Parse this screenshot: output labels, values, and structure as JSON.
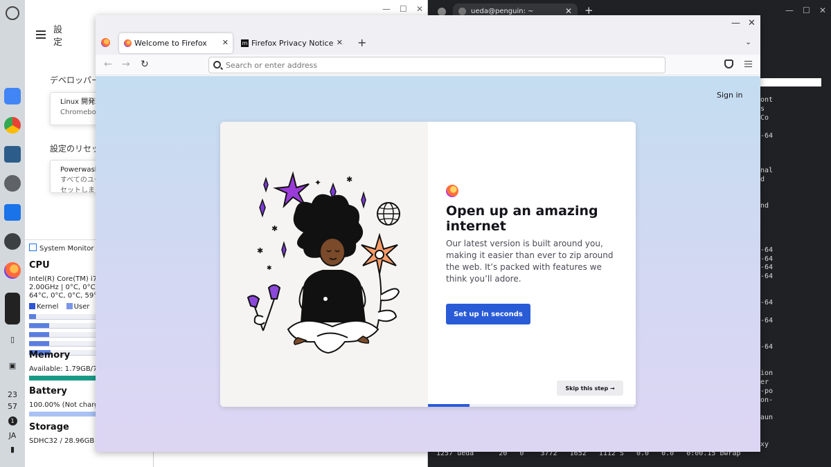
{
  "shelf": {
    "apps": [
      "files-icon",
      "chrome-icon",
      "gallery-icon",
      "settings-icon",
      "system-monitor-icon",
      "terminal-icon",
      "firefox-icon",
      "media-icon"
    ],
    "tray": {
      "hour": "23",
      "minute": "57",
      "notifications": "1",
      "ime": "JA"
    }
  },
  "settings": {
    "title": "設定",
    "developer_section": "デベロッパー",
    "linux_card_title": "Linux 開発環",
    "linux_card_sub": "Chromebook",
    "reset_section": "設定のリセッ",
    "powerwash_title": "Powerwash",
    "powerwash_sub1": "すべてのユー",
    "powerwash_sub2": "セットします"
  },
  "sysmon": {
    "title": "System Monitor",
    "cpu_heading": "CPU",
    "cpu_line1": "Intel(R) Core(TM) i7-",
    "cpu_line2": "2.00GHz | 0°C, 0°C, 0",
    "cpu_line3": "64°C, 0°C, 0°C, 59°C,",
    "legend_kernel": "Kernel",
    "legend_user": "User",
    "cpu_bars": [
      0.1,
      0.3,
      0.3,
      0.3,
      0.32
    ],
    "memory_heading": "Memory",
    "memory_text": "Available: 1.79GB/7.",
    "battery_heading": "Battery",
    "battery_text": "100.00% (Not chargi",
    "storage_heading": "Storage",
    "storage_text": "SDHC32 / 28.96GB",
    "colors": {
      "kernel": "#2f55d4",
      "user": "#7b96e8"
    }
  },
  "terminal": {
    "tab_title": "ueda@penguin: ~",
    "right_lines": [
      "ont",
      "s",
      " Co",
      "-64",
      "nal",
      "d",
      "nd",
      "-64",
      "-64",
      "-64",
      "-64",
      "-64",
      "-64",
      "-64",
      "ion",
      "er",
      "-po",
      "on-",
      "aun",
      "xy"
    ],
    "bottom_line": "1257 ueda      20   0    3772   1652   1112 S   0.0   0.0   0:00.15 bwrap"
  },
  "firefox": {
    "tabs": [
      {
        "label": "Welcome to Firefox",
        "active": true
      },
      {
        "label": "Firefox Privacy Notice — ",
        "active": false
      }
    ],
    "url_placeholder": "Search or enter address",
    "sign_in": "Sign in",
    "onboarding": {
      "heading": "Open up an amazing internet",
      "body": "Our latest version is built around you, making it easier than ever to zip around the web. It’s packed with features we think you’ll adore.",
      "cta": "Set up in seconds",
      "skip": "Skip this step →",
      "progress": 0.2
    }
  }
}
